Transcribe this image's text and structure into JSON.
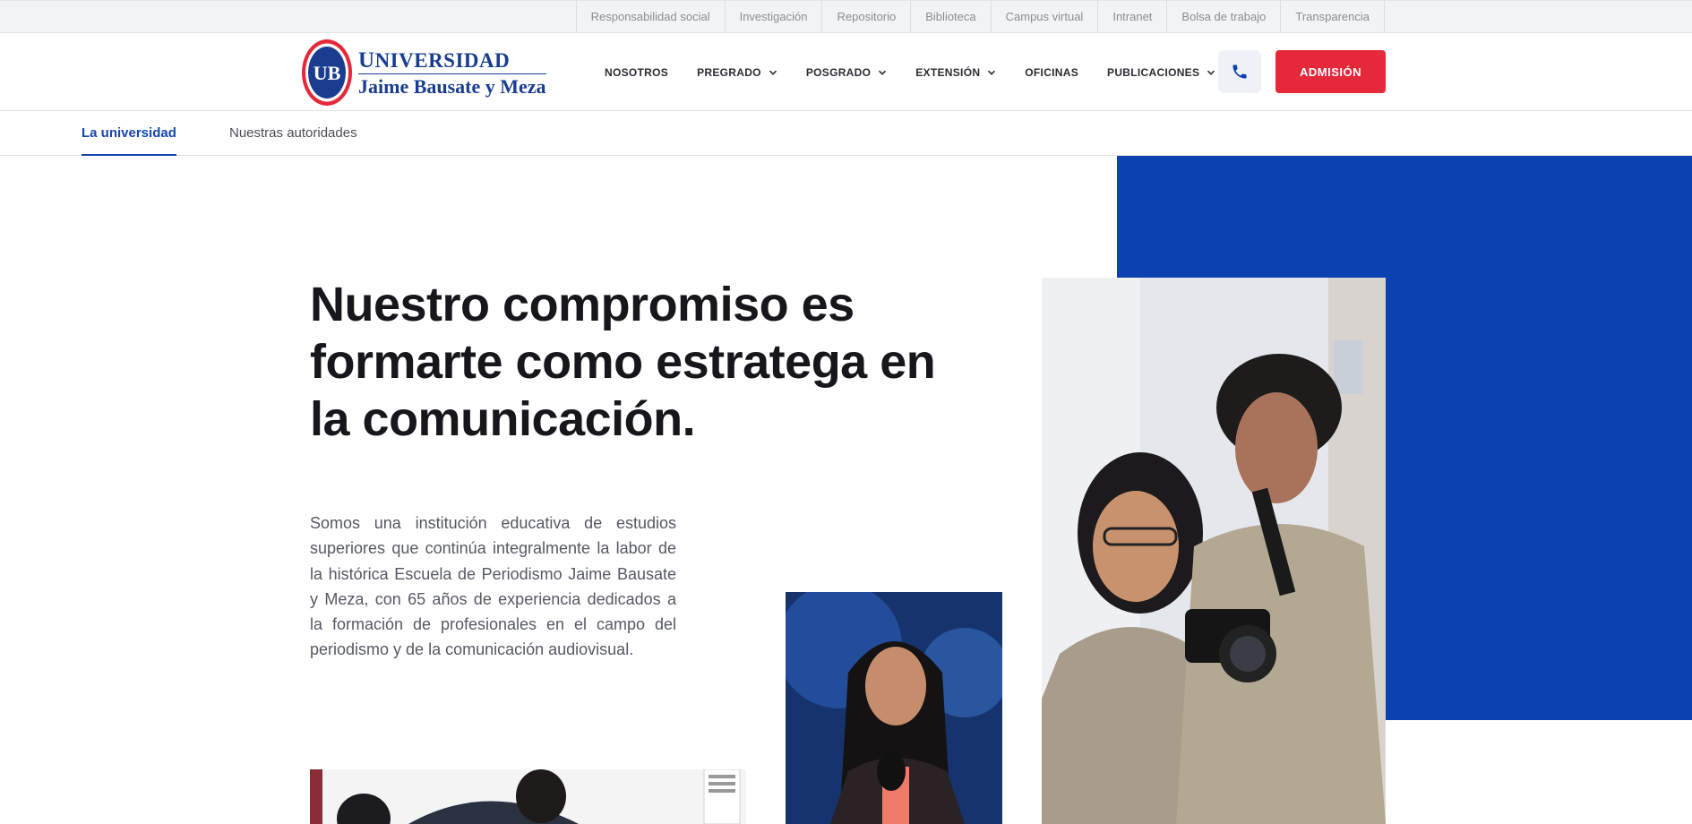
{
  "topbar": {
    "links": [
      "Responsabilidad social",
      "Investigación",
      "Repositorio",
      "Biblioteca",
      "Campus virtual",
      "Intranet",
      "Bolsa de trabajo",
      "Transparencia"
    ]
  },
  "header": {
    "logo": {
      "seal_text": "UB",
      "line1_cap": "U",
      "line1_rest": "NIVERSIDAD",
      "line2": "Jaime Bausate y Meza"
    },
    "nav": [
      {
        "label": "NOSOTROS",
        "dropdown": false
      },
      {
        "label": "PREGRADO",
        "dropdown": true
      },
      {
        "label": "POSGRADO",
        "dropdown": true
      },
      {
        "label": "EXTENSIÓN",
        "dropdown": true
      },
      {
        "label": "OFICINAS",
        "dropdown": false
      },
      {
        "label": "PUBLICACIONES",
        "dropdown": true
      }
    ],
    "phone_icon": "phone-icon",
    "admission_label": "ADMISIÓN"
  },
  "subtabs": {
    "items": [
      {
        "label": "La universidad",
        "active": true
      },
      {
        "label": "Nuestras autoridades",
        "active": false
      }
    ]
  },
  "hero": {
    "title": "Nuestro compromiso es formarte como estratega en la comunicación.",
    "body": "Somos una institución educativa de estudios superiores que continúa integralmente la labor de la histórica Escuela de Periodismo Jaime Bausate y Meza, con 65 años de experiencia dedicados a la formación de profesionales en el campo del periodismo y de la comunicación audiovisual."
  },
  "colors": {
    "brand_blue": "#0c41b0",
    "accent_red": "#e5293b",
    "active_tab": "#1546b2",
    "logo_blue": "#1a3d8f"
  }
}
